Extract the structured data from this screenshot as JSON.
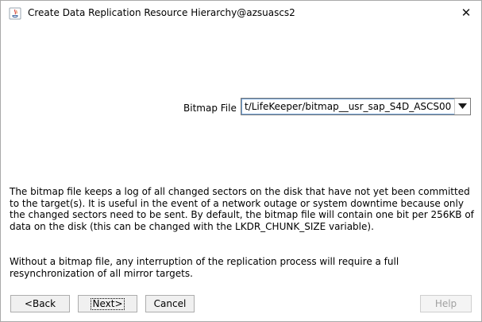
{
  "window": {
    "title": "Create Data Replication Resource Hierarchy@azsuascs2",
    "close_symbol": "✕"
  },
  "form": {
    "bitmap_label": "Bitmap File",
    "bitmap_value": "t/LifeKeeper/bitmap__usr_sap_S4D_ASCS00"
  },
  "description": {
    "paragraph1": "The bitmap file keeps a log of all changed sectors on the disk that have not yet been committed to the target(s). It is useful in the event of a network outage or system downtime because only the changed sectors need to be sent. By default, the bitmap file will contain one bit per 256KB of data on the disk (this can be changed with the LKDR_CHUNK_SIZE variable).",
    "paragraph2": "Without a bitmap file, any interruption of the replication process will require a full resynchronization of all mirror targets."
  },
  "buttons": {
    "back": "<Back",
    "next": "Next>",
    "cancel": "Cancel",
    "help": "Help"
  },
  "icons": {
    "app": "java-app-icon",
    "dropdown": "chevron-down-icon",
    "close": "close-icon"
  }
}
